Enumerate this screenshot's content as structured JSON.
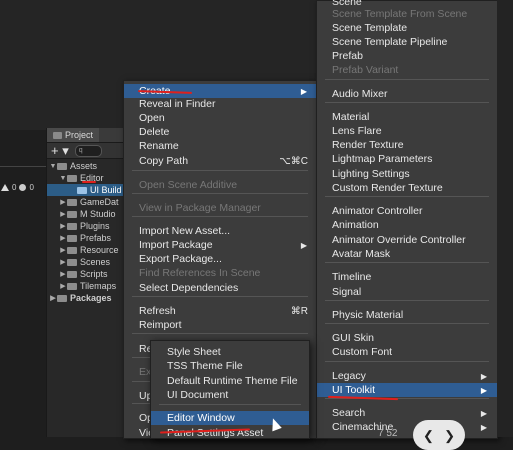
{
  "project_panel": {
    "tab_label": "Project",
    "add_label": "+ ▾",
    "search_placeholder": "q",
    "tree": [
      {
        "label": "Assets",
        "level": 0,
        "expanded": true
      },
      {
        "label": "Editor",
        "level": 1,
        "expanded": true
      },
      {
        "label": "UI Build",
        "level": 2,
        "selected": true
      },
      {
        "label": "GameDat",
        "level": 1
      },
      {
        "label": "M Studio",
        "level": 1
      },
      {
        "label": "Plugins",
        "level": 1
      },
      {
        "label": "Prefabs",
        "level": 1
      },
      {
        "label": "Resource",
        "level": 1
      },
      {
        "label": "Scenes",
        "level": 1
      },
      {
        "label": "Scripts",
        "level": 1
      },
      {
        "label": "Tilemaps",
        "level": 1
      },
      {
        "label": "Packages",
        "level": 0,
        "bold": true
      }
    ]
  },
  "console_counts": {
    "warnings": "0",
    "errors": "0"
  },
  "context_menu": {
    "items": [
      {
        "label": "Create",
        "submenu": true,
        "highlighted": true
      },
      {
        "label": "Reveal in Finder"
      },
      {
        "label": "Open"
      },
      {
        "label": "Delete"
      },
      {
        "label": "Rename"
      },
      {
        "label": "Copy Path",
        "shortcut": "⌥⌘C"
      },
      {
        "label": "Open Scene Additive",
        "disabled": true
      },
      {
        "label": "View in Package Manager",
        "disabled": true
      },
      {
        "label": "Import New Asset..."
      },
      {
        "label": "Import Package",
        "submenu": true
      },
      {
        "label": "Export Package..."
      },
      {
        "label": "Find References In Scene",
        "disabled": true
      },
      {
        "label": "Select Dependencies"
      },
      {
        "label": "Refresh",
        "shortcut": "⌘R"
      },
      {
        "label": "Reimport"
      },
      {
        "label": "Re"
      },
      {
        "label": "Ex",
        "disabled": true
      },
      {
        "label": "Up"
      },
      {
        "label": "Op"
      },
      {
        "label": "Vie"
      }
    ]
  },
  "create_submenu": {
    "items": [
      {
        "label": "Scene"
      },
      {
        "label": "Scene Template From Scene",
        "disabled": true
      },
      {
        "label": "Scene Template"
      },
      {
        "label": "Scene Template Pipeline"
      },
      {
        "label": "Prefab"
      },
      {
        "label": "Prefab Variant",
        "disabled": true
      },
      {
        "label": "Audio Mixer"
      },
      {
        "label": "Material"
      },
      {
        "label": "Lens Flare"
      },
      {
        "label": "Render Texture"
      },
      {
        "label": "Lightmap Parameters"
      },
      {
        "label": "Lighting Settings"
      },
      {
        "label": "Custom Render Texture"
      },
      {
        "label": "Animator Controller"
      },
      {
        "label": "Animation"
      },
      {
        "label": "Animator Override Controller"
      },
      {
        "label": "Avatar Mask"
      },
      {
        "label": "Timeline"
      },
      {
        "label": "Signal"
      },
      {
        "label": "Physic Material"
      },
      {
        "label": "GUI Skin"
      },
      {
        "label": "Custom Font"
      },
      {
        "label": "Legacy",
        "submenu": true
      },
      {
        "label": "UI Toolkit",
        "submenu": true,
        "highlighted": true
      },
      {
        "label": "Search",
        "submenu": true
      },
      {
        "label": "Cinemachine",
        "submenu": true
      }
    ]
  },
  "ui_toolkit_submenu": {
    "items": [
      {
        "label": "Style Sheet"
      },
      {
        "label": "TSS Theme File"
      },
      {
        "label": "Default Runtime Theme File"
      },
      {
        "label": "UI Document"
      },
      {
        "label": "Editor Window",
        "highlighted": true
      },
      {
        "label": "Panel Settings Asset"
      }
    ]
  },
  "bottom_overlay": {
    "number": "7 52"
  },
  "colors": {
    "highlight": "#2f5d93",
    "annotation": "#e0201c",
    "menu_bg": "#3c3c3c"
  }
}
